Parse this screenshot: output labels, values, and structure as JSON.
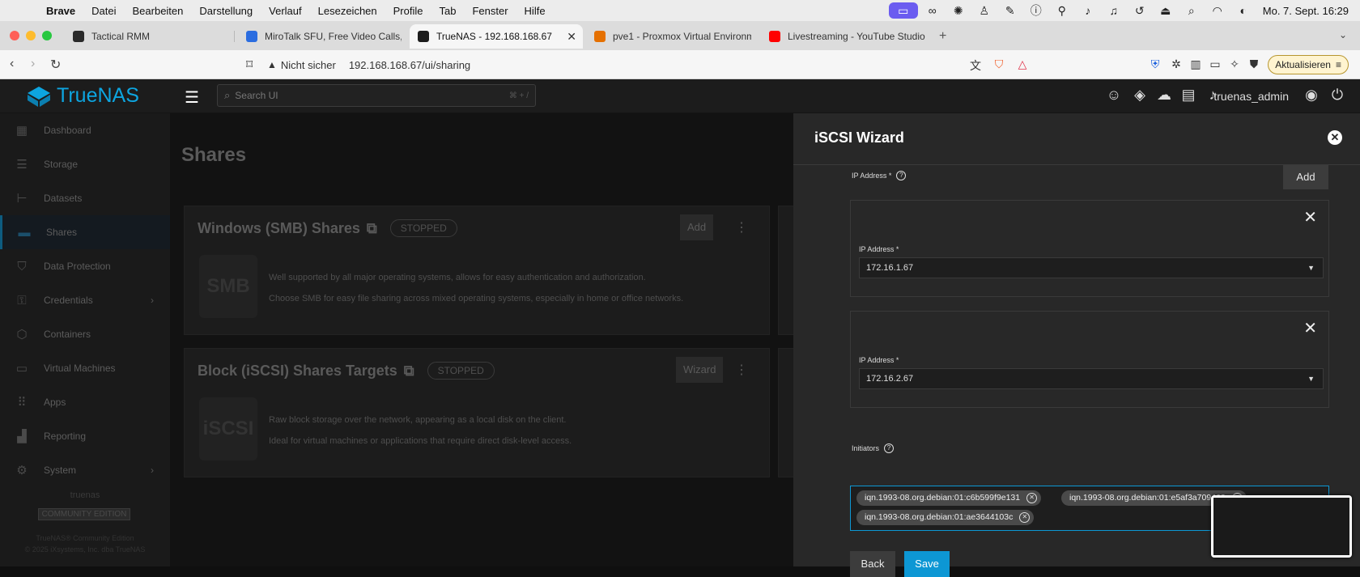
{
  "menubar": {
    "app": "Brave",
    "items": [
      "Datei",
      "Bearbeiten",
      "Darstellung",
      "Verlauf",
      "Lesezeichen",
      "Profile",
      "Tab",
      "Fenster",
      "Hilfe"
    ],
    "clock": "Mo. 7. Sept.  16:29"
  },
  "tabs": [
    {
      "label": "Tactical RMM",
      "icon": "tactical-rmm-icon",
      "color": "#2a2a2a"
    },
    {
      "label": "MiroTalk SFU, Free Video Calls,",
      "icon": "mirotalk-icon",
      "color": "#2b6de0"
    },
    {
      "label": "TrueNAS - 192.168.168.67",
      "icon": "truenas-icon",
      "color": "#1c1c1c"
    },
    {
      "label": "pve1 - Proxmox Virtual Environmen",
      "icon": "proxmox-icon",
      "color": "#e57000"
    },
    {
      "label": "Livestreaming - YouTube Studio",
      "icon": "youtube-icon",
      "color": "#ff0000"
    }
  ],
  "address": {
    "security": "Nicht sicher",
    "url": "192.168.168.67/ui/sharing",
    "update_label": "Aktualisieren"
  },
  "app": {
    "brand": "TrueNAS",
    "search_placeholder": "Search UI",
    "search_shortcut": "⌘ + /",
    "user": "truenas_admin"
  },
  "sidebar": {
    "items": [
      {
        "label": "Dashboard",
        "icon": "dashboard-icon"
      },
      {
        "label": "Storage",
        "icon": "storage-icon"
      },
      {
        "label": "Datasets",
        "icon": "datasets-icon"
      },
      {
        "label": "Shares",
        "icon": "shares-icon"
      },
      {
        "label": "Data Protection",
        "icon": "shield-icon"
      },
      {
        "label": "Credentials",
        "icon": "key-icon"
      },
      {
        "label": "Containers",
        "icon": "cube-icon"
      },
      {
        "label": "Virtual Machines",
        "icon": "laptop-icon"
      },
      {
        "label": "Apps",
        "icon": "apps-grid-icon"
      },
      {
        "label": "Reporting",
        "icon": "chart-icon"
      },
      {
        "label": "System",
        "icon": "gear-icon"
      }
    ],
    "hostname": "truenas",
    "edition": "COMMUNITY EDITION",
    "copyright1": "TrueNAS® Community Edition",
    "copyright2": "© 2025 iXsystems, Inc. dba TrueNAS"
  },
  "shares": {
    "title": "Shares",
    "smb": {
      "title": "Windows (SMB) Shares",
      "status": "STOPPED",
      "add_label": "Add",
      "icon_text": "SMB",
      "desc1": "Well supported by all major operating systems, allows for easy authentication and authorization.",
      "desc2": "Choose SMB for easy file sharing across mixed operating systems, especially in home or office networks."
    },
    "iscsi": {
      "title": "Block (iSCSI) Shares Targets",
      "status": "STOPPED",
      "wizard_label": "Wizard",
      "icon_text": "iSCSI",
      "desc1": "Raw block storage over the network, appearing as a local disk on the client.",
      "desc2": "Ideal for virtual machines or applications that require direct disk-level access."
    }
  },
  "wizard": {
    "title": "iSCSI Wizard",
    "ip_label": "IP Address *",
    "add_label": "Add",
    "ip_entries": [
      {
        "label": "IP Address *",
        "value": "172.16.1.67"
      },
      {
        "label": "IP Address *",
        "value": "172.16.2.67"
      }
    ],
    "initiators_label": "Initiators",
    "initiators": [
      "iqn.1993-08.org.debian:01:c6b599f9e131",
      "iqn.1993-08.org.debian:01:e5af3a709463",
      "iqn.1993-08.org.debian:01:ae3644103c"
    ],
    "back_label": "Back",
    "save_label": "Save"
  }
}
